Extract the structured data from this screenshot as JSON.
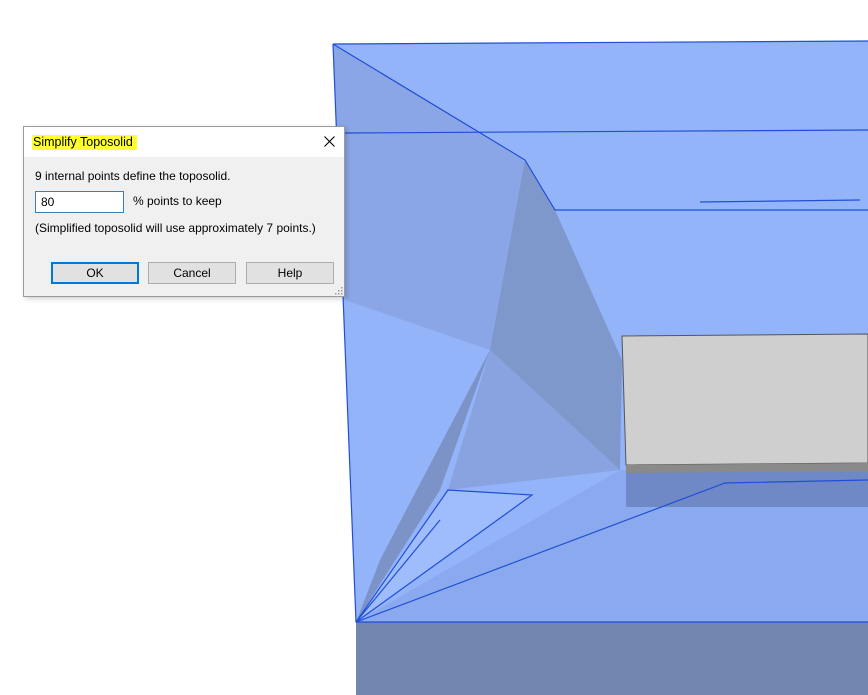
{
  "dialog": {
    "title": "Simplify Toposolid",
    "info_text": "9 internal points define the toposolid.",
    "keep_value": "80",
    "keep_label": "% points to keep",
    "approx_text": "(Simplified toposolid will use approximately 7 points.)",
    "ok_label": "OK",
    "cancel_label": "Cancel",
    "help_label": "Help",
    "close_icon": "close-icon",
    "title_highlight": "#ffff33"
  },
  "scene": {
    "toposolid_fill": "#94b4fa",
    "edge_color": "#1f4fd6",
    "side_fill": "#7186af",
    "box_fill": "#cfcfcf"
  }
}
